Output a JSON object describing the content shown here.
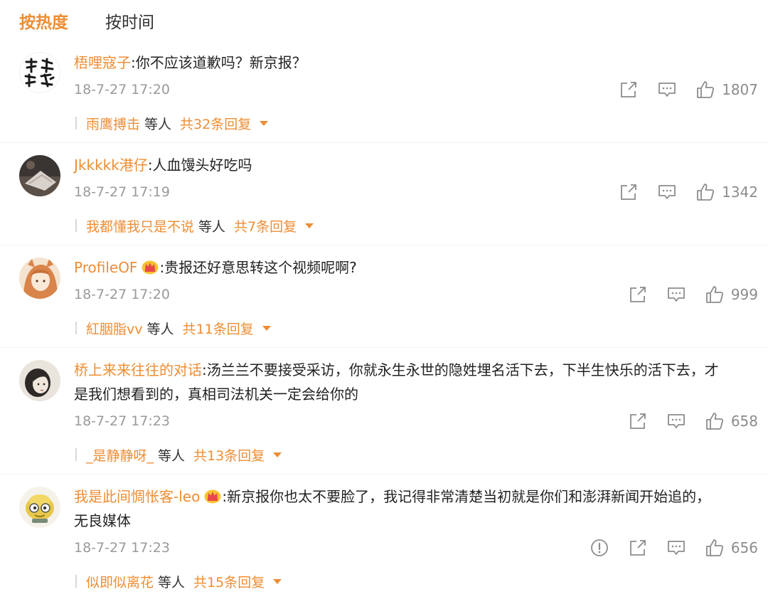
{
  "tabs": [
    {
      "label": "按热度",
      "active": true
    },
    {
      "label": "按时间",
      "active": false
    }
  ],
  "accent_color": "#ee8d34",
  "comments": [
    {
      "user": "梧哩寇子",
      "text": ":你不应该道歉吗？新京报？",
      "text2": "",
      "crown": false,
      "time": "18-7-27 17:20",
      "likes": "1807",
      "report": false,
      "reply_users": "雨鹰搏击",
      "reply_etc": "等人",
      "reply_count": "共32条回复"
    },
    {
      "user": "Jkkkkk港仔",
      "text": ":人血馒头好吃吗",
      "text2": "",
      "crown": false,
      "time": "18-7-27 17:19",
      "likes": "1342",
      "report": false,
      "reply_users": "我都懂我只是不说",
      "reply_etc": "等人",
      "reply_count": "共7条回复"
    },
    {
      "user": "ProfileOF",
      "text": ":贵报还好意思转这个视频呢啊?",
      "text2": "",
      "crown": true,
      "time": "18-7-27 17:20",
      "likes": "999",
      "report": false,
      "reply_users": "紅胭脂vv",
      "reply_etc": "等人",
      "reply_count": "共11条回复"
    },
    {
      "user": "桥上来来往往的对话",
      "text": ":汤兰兰不要接受采访，你就永生永世的隐姓埋名活下去，下半生快乐的活下去，才",
      "text2": "是我们想看到的，真相司法机关一定会给你的",
      "crown": false,
      "time": "18-7-27 17:23",
      "likes": "658",
      "report": false,
      "reply_users": "_是静静呀_",
      "reply_etc": "等人",
      "reply_count": "共13条回复"
    },
    {
      "user": "我是此间惆怅客-leo",
      "text": ":新京报你也太不要脸了，我记得非常清楚当初就是你们和澎湃新闻开始追的，",
      "text2": "无良媒体",
      "crown": true,
      "time": "18-7-27 17:23",
      "likes": "656",
      "report": true,
      "reply_users": "似即似离花",
      "reply_etc": "等人",
      "reply_count": "共15条回复"
    }
  ]
}
